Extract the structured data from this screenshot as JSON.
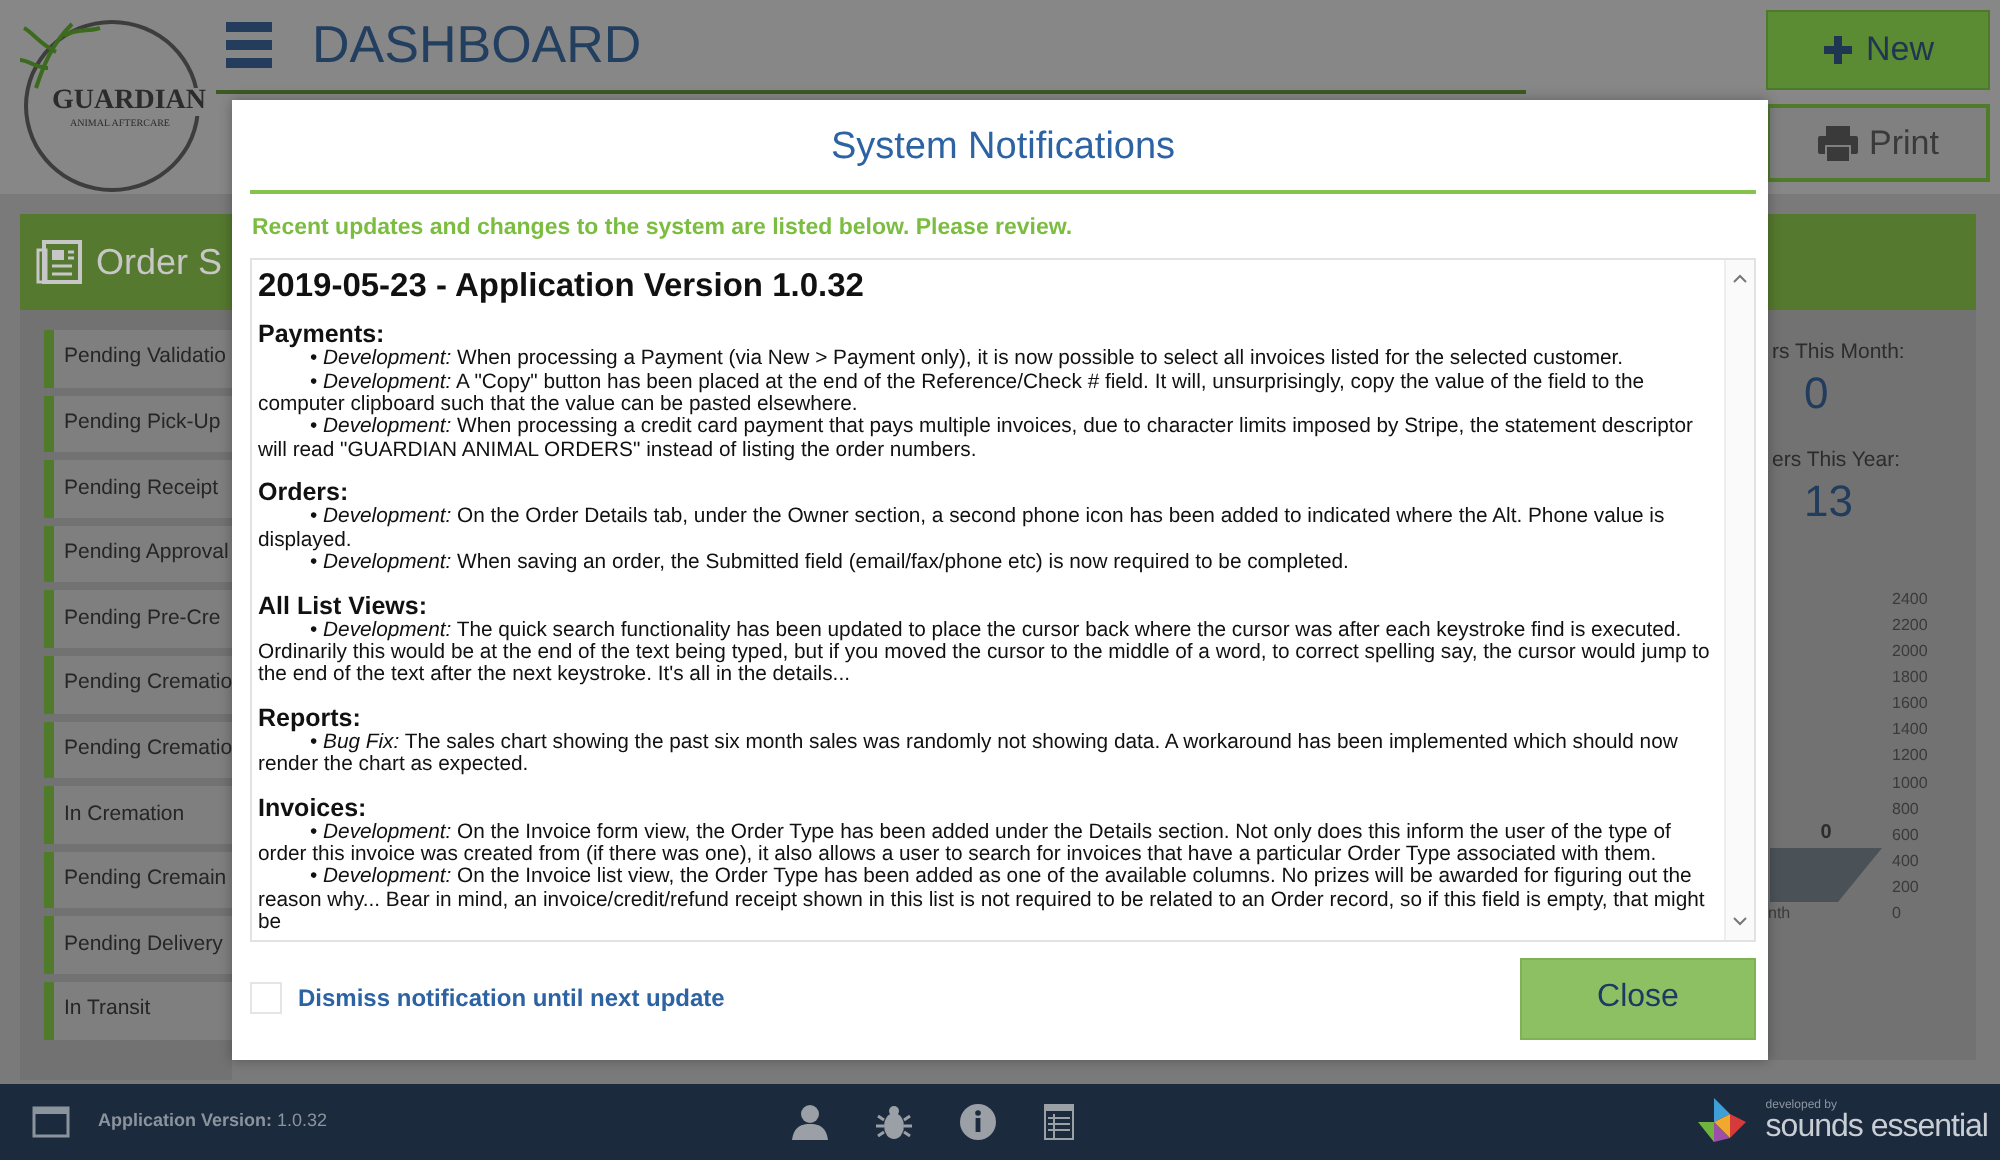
{
  "header": {
    "logo": {
      "name": "GUARDIAN",
      "tagline": "ANIMAL AFTERCARE"
    },
    "title": "DASHBOARD",
    "buttons": [
      {
        "kind": "new",
        "label": "New"
      },
      {
        "kind": "print",
        "label": "Print"
      }
    ]
  },
  "order_panel": {
    "title": "Order S",
    "items": [
      "Pending Validatio",
      "Pending Pick-Up",
      "Pending Receipt",
      "Pending Approval",
      "Pending Pre-Cre",
      "Pending Crematio",
      "Pending Crematio",
      "In Cremation",
      "Pending Cremain",
      "Pending Delivery",
      "In Transit"
    ]
  },
  "stats_panel": {
    "stats": [
      {
        "label": "rs This Month:",
        "value": "0"
      },
      {
        "label": "ers This Year:",
        "value": "13"
      }
    ],
    "axis_labels": [
      "2400",
      "2200",
      "2000",
      "1800",
      "1600",
      "1400",
      "1200",
      "1000",
      "800",
      "600",
      "400",
      "200",
      "0"
    ],
    "bar_label": "0",
    "axis_title": "nth"
  },
  "modal": {
    "title": "System Notifications",
    "subtitle": "Recent updates and changes to the system are listed below. Please review.",
    "release_title": "2019-05-23 - Application Version 1.0.32",
    "sections": [
      {
        "heading": "Payments:",
        "items": [
          "• *Development:* When processing a Payment (via New > Payment only), it is now possible to select all invoices listed for the selected customer.",
          "• *Development:* A \"Copy\" button has been placed at the end of the Reference/Check # field. It will, unsurprisingly, copy the value of the field to the computer clipboard such that the value can be pasted elsewhere.",
          "• *Development:* When processing a credit card payment that pays multiple invoices, due to character limits imposed by Stripe, the statement descriptor will read \"GUARDIAN ANIMAL ORDERS\" instead of listing the order numbers."
        ]
      },
      {
        "heading": "Orders:",
        "items": [
          "• *Development:* On the Order Details tab, under the Owner section, a second phone icon has been added to indicated where the Alt. Phone value is displayed.",
          "• *Development:* When saving an order, the Submitted field (email/fax/phone etc) is now required to be completed."
        ]
      },
      {
        "heading": "All List Views:",
        "items": [
          "• *Development:* The quick search functionality has been updated to place the cursor back where the cursor was after each keystroke find is executed. Ordinarily this would be at the end of the text being typed, but if you moved the cursor to the middle of a word, to correct spelling say, the cursor would jump to the end of the text after the next keystroke. It's all in the details..."
        ]
      },
      {
        "heading": "Reports:",
        "items": [
          "• *Bug Fix:* The sales chart showing the past six month sales was randomly not showing data. A workaround has been implemented which should now render the chart as expected."
        ]
      },
      {
        "heading": "Invoices:",
        "items": [
          "• *Development:* On the Invoice form view, the Order Type has been added under the Details section. Not only does this inform the user of the type of order this invoice was created from (if there was one), it also allows a user to search for invoices that have a particular Order Type associated with them.",
          "• *Development:* On the Invoice list view, the Order Type has been added as one of the available columns. No prizes will be awarded for figuring out the reason why... Bear in mind, an invoice/credit/refund receipt shown in this list is not required to be related to an Order record, so if this field is empty, that might be"
        ]
      }
    ],
    "dismiss": {
      "label": "Dismiss notification until next update",
      "checked": false
    },
    "close_label": "Close"
  },
  "footer": {
    "version_label": "Application Version:",
    "version": "1.0.32",
    "developer": {
      "caption": "developed by",
      "name": "sounds essential"
    }
  }
}
